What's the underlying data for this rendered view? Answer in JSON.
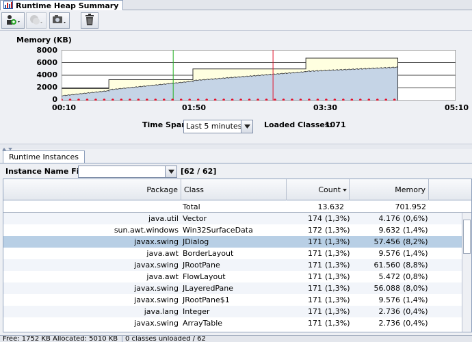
{
  "window": {
    "tab_title": "Runtime Heap Summary"
  },
  "toolbar": {
    "buttons": [
      {
        "name": "add-snapshot-icon"
      },
      {
        "name": "compare-icon"
      },
      {
        "name": "camera-icon"
      },
      {
        "name": "tools-icon"
      },
      {
        "name": "trash-icon"
      }
    ]
  },
  "chart_data": {
    "type": "area",
    "title": "Memory (KB)",
    "ylim": [
      0,
      8000
    ],
    "yticks": [
      "8000",
      "6000",
      "4000",
      "2000",
      "0"
    ],
    "xticks": [
      "00:10",
      "01:50",
      "03:30",
      "05:10"
    ],
    "xlim_seconds": [
      10,
      310
    ],
    "series": [
      {
        "name": "",
        "type": "step",
        "points": [
          [
            10,
            1900
          ],
          [
            46,
            1900
          ],
          [
            46,
            3300
          ],
          [
            110,
            3300
          ],
          [
            110,
            5000
          ],
          [
            196,
            5000
          ],
          [
            196,
            6700
          ],
          [
            266,
            6700
          ]
        ],
        "color": "#ffffe0"
      },
      {
        "name": "",
        "type": "sawtooth",
        "points": [
          [
            10,
            700
          ],
          [
            46,
            1500
          ],
          [
            46,
            1650
          ],
          [
            110,
            3000
          ],
          [
            110,
            3100
          ],
          [
            196,
            4500
          ],
          [
            196,
            4550
          ],
          [
            266,
            5200
          ]
        ],
        "color": "#c5d4e6"
      }
    ],
    "gc_markers_color": "#e0102a",
    "vertical_markers": [
      {
        "x": 95,
        "color": "#20b020"
      },
      {
        "x": 171,
        "color": "#e0102a"
      }
    ]
  },
  "timespan": {
    "label": "Time Span:",
    "value": "Last 5 minutes"
  },
  "loaded_classes": {
    "label": "Loaded Classes:",
    "value": "1071"
  },
  "instances_tab": {
    "label": "Runtime Instances"
  },
  "filter": {
    "label": "Instance Name Filter:",
    "value": "",
    "count": "[62 / 62]"
  },
  "table": {
    "headers": {
      "package": "Package",
      "class": "Class",
      "count": "Count",
      "memory": "Memory"
    },
    "total": {
      "class": "Total",
      "count": "13.632",
      "memory": "701.952"
    },
    "rows": [
      {
        "package": "java.util",
        "class": "Vector",
        "count": "174",
        "count_pct": "(1,3%)",
        "memory": "4.176",
        "memory_pct": "(0,6%)",
        "selected": false
      },
      {
        "package": "sun.awt.windows",
        "class": "Win32SurfaceData",
        "count": "172",
        "count_pct": "(1,3%)",
        "memory": "9.632",
        "memory_pct": "(1,4%)",
        "selected": false
      },
      {
        "package": "javax.swing",
        "class": "JDialog",
        "count": "171",
        "count_pct": "(1,3%)",
        "memory": "57.456",
        "memory_pct": "(8,2%)",
        "selected": true
      },
      {
        "package": "java.awt",
        "class": "BorderLayout",
        "count": "171",
        "count_pct": "(1,3%)",
        "memory": "9.576",
        "memory_pct": "(1,4%)",
        "selected": false
      },
      {
        "package": "javax.swing",
        "class": "JRootPane",
        "count": "171",
        "count_pct": "(1,3%)",
        "memory": "61.560",
        "memory_pct": "(8,8%)",
        "selected": false
      },
      {
        "package": "java.awt",
        "class": "FlowLayout",
        "count": "171",
        "count_pct": "(1,3%)",
        "memory": "5.472",
        "memory_pct": "(0,8%)",
        "selected": false
      },
      {
        "package": "javax.swing",
        "class": "JLayeredPane",
        "count": "171",
        "count_pct": "(1,3%)",
        "memory": "56.088",
        "memory_pct": "(8,0%)",
        "selected": false
      },
      {
        "package": "javax.swing",
        "class": "JRootPane$1",
        "count": "171",
        "count_pct": "(1,3%)",
        "memory": "9.576",
        "memory_pct": "(1,4%)",
        "selected": false
      },
      {
        "package": "java.lang",
        "class": "Integer",
        "count": "171",
        "count_pct": "(1,3%)",
        "memory": "2.736",
        "memory_pct": "(0,4%)",
        "selected": false
      },
      {
        "package": "javax.swing",
        "class": "ArrayTable",
        "count": "171",
        "count_pct": "(1,3%)",
        "memory": "2.736",
        "memory_pct": "(0,4%)",
        "selected": false
      }
    ]
  },
  "status": {
    "left": "Free: 1752 KB   Allocated: 5010 KB",
    "right": "0 classes unloaded / 62"
  }
}
